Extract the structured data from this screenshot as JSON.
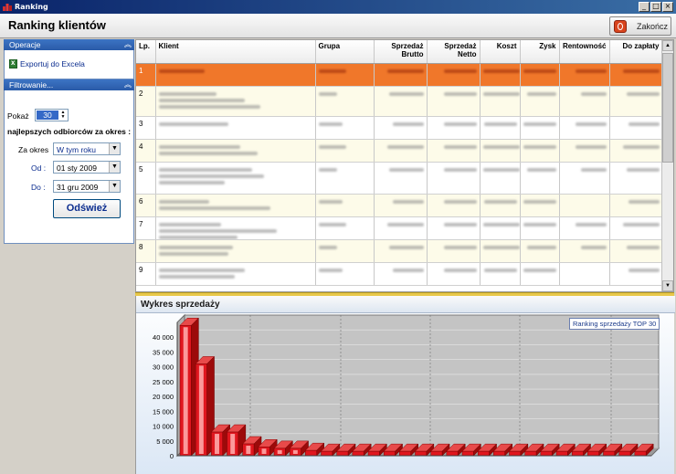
{
  "window": {
    "title": "Ranking"
  },
  "header": {
    "title": "Ranking klientów",
    "close_label": "Zakończ"
  },
  "sidebar": {
    "operations": {
      "title": "Operacje",
      "export_label": "Exportuj do Excela"
    },
    "filter": {
      "title": "Filtrowanie...",
      "show_label": "Pokaż",
      "show_value": "30",
      "best_label": "najlepszych odbiorców za okres :",
      "period_label": "Za okres",
      "period_value": "W tym roku",
      "from_label": "Od :",
      "from_value": "01 sty 2009",
      "to_label": "Do :",
      "to_value": "31 gru 2009",
      "refresh_label": "Odśwież"
    }
  },
  "table": {
    "columns": [
      "Lp.",
      "Klient",
      "Grupa",
      "Sprzedaż Brutto",
      "Sprzedaż Netto",
      "Koszt",
      "Zysk",
      "Rentowność",
      "Do zapłaty"
    ],
    "rows": [
      {
        "lp": "1"
      },
      {
        "lp": "2"
      },
      {
        "lp": "3"
      },
      {
        "lp": "4"
      },
      {
        "lp": "5"
      },
      {
        "lp": "6"
      },
      {
        "lp": "7"
      },
      {
        "lp": "8"
      },
      {
        "lp": "9"
      }
    ],
    "selected_row": 1
  },
  "chart": {
    "panel_title": "Wykres sprzedaży",
    "legend": "Ranking sprzedaży TOP 30"
  },
  "chart_data": {
    "type": "bar",
    "title": "",
    "xlabel": "",
    "ylabel": "",
    "ylim": [
      0,
      45000
    ],
    "yticks": [
      0,
      5000,
      10000,
      15000,
      20000,
      25000,
      30000,
      35000,
      40000
    ],
    "ytick_labels": [
      "0",
      "5 000",
      "10 000",
      "15 000",
      "20 000",
      "25 000",
      "30 000",
      "35 000",
      "40 000"
    ],
    "series": [
      {
        "values": [
          44000,
          31000,
          8000,
          8000,
          4000,
          3000,
          2500,
          2500,
          1800,
          1500,
          1500,
          1500,
          1500,
          1500,
          1500,
          1500,
          1500,
          1500,
          1500,
          1500,
          1500,
          1500,
          1500,
          1500,
          1500,
          1500,
          1500,
          1500,
          1500,
          1500
        ]
      }
    ],
    "grid": true,
    "legend_position": "top-right",
    "bar_color": "#e0161e"
  },
  "colors": {
    "selected_row": "#f0772a",
    "alt_row": "#fdfbe9",
    "sidebar_header": "#2a5ba8",
    "bar": "#e0161e",
    "plot_background": "#c4c4c4"
  }
}
